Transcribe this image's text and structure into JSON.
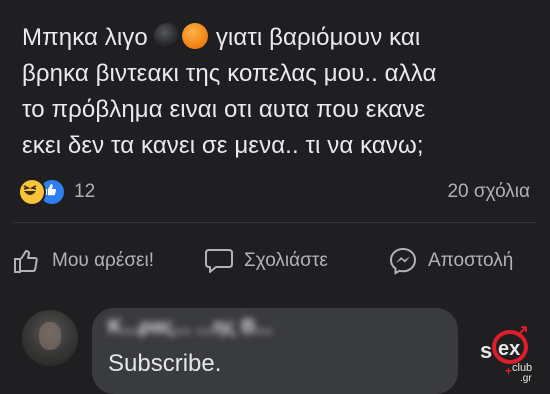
{
  "post": {
    "line1_before": "Μπηκα λιγο",
    "line1_after": "γιατι βαριόμουν και",
    "line2": "βρηκα βιντεακι της κοπελας μου.. αλλα",
    "line3": "το πρόβλημα ειναι οτι αυτα που εκανε",
    "line4": "εκει δεν τα κανει σε μενα.. τι να κανω;",
    "inline_emojis": [
      "dark-ball-emoji",
      "orange-ball-emoji"
    ]
  },
  "reactions": {
    "icons": [
      "haha-reaction-icon",
      "like-reaction-icon"
    ],
    "count": "12",
    "comments": "20 σχόλια"
  },
  "actions": {
    "like": "Μου αρέσει!",
    "comment": "Σχολιάστε",
    "share": "Αποστολή"
  },
  "comment": {
    "author": "Κ...ρας... ...ης Β...",
    "text": "Subscribe."
  },
  "watermark": {
    "brand": "sexclub",
    "domain": ".gr"
  },
  "colors": {
    "background": "#1f1f21",
    "text": "#e9eaee",
    "muted": "#b0b3b8",
    "bubble": "#3a3b3d",
    "like_blue": "#2e7ef0",
    "haha_yellow": "#f7c43a",
    "watermark_red": "#e01d2b"
  }
}
